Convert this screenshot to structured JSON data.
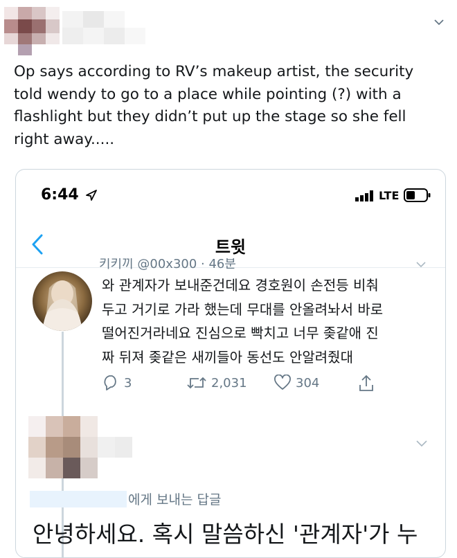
{
  "tweet": {
    "text": "Op says according to RV’s makeup artist, the security\ntold wendy to go to a place while pointing (?) with a\nflashlight but they didn’t put up the stage so she fell\nright away....."
  },
  "embed": {
    "status_time": "6:44",
    "network": "LTE",
    "screen_title": "트윗",
    "cut_name": "키키끼 @00x300 · 46분",
    "text": "와 관계자가 보내준건데요 경호원이 손전등 비춰\n두고 거기로 가라 했는데 무대를 안올려놔서 바로\n떨어진거라네요 진심으로 빡치고 너무 좆같애 진\n짜 뒤져 좆같은 새끼들아 동선도 안알려줬대",
    "actions": {
      "replies": "3",
      "retweets": "2,031",
      "likes": "304"
    },
    "reply_to_suffix": "에게 보내는 답글",
    "reply_text": "안녕하세요. 혹시 말씀하신 '관계자'가 누"
  },
  "colors": {
    "accent": "#1da1f2",
    "muted": "#657786",
    "text": "#14171a",
    "border": "#ccd6dd"
  },
  "icons": {
    "status": [
      "location-arrow-icon",
      "signal-icon",
      "battery-icon"
    ],
    "nav": [
      "back-chevron-icon"
    ],
    "actions": [
      "reply-icon",
      "retweet-icon",
      "like-icon",
      "share-icon"
    ],
    "menu": [
      "chevron-down-icon"
    ]
  }
}
